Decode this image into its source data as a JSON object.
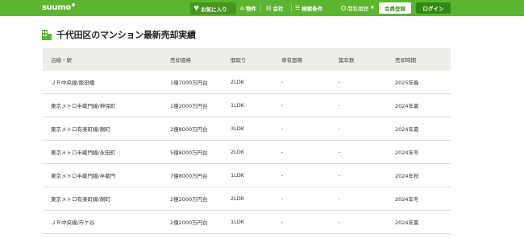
{
  "header": {
    "logo": "suumo",
    "favorites_label": "お気に入り",
    "nav": [
      {
        "label": "物件",
        "icon": "house-icon"
      },
      {
        "label": "会社",
        "icon": "building-icon"
      },
      {
        "label": "検索条件",
        "icon": "search-list-icon"
      }
    ],
    "recent_label": "閲覧履歴",
    "register_label": "会員登録",
    "login_label": "ログイン",
    "colors": {
      "brand": "#5cb531",
      "dark": "#2f8a12"
    }
  },
  "page": {
    "title": "千代田区のマンション最新売却実績",
    "title_icon": "building-icon"
  },
  "table": {
    "headers": [
      "沿線・駅",
      "売却価格",
      "間取り",
      "専有面積",
      "築年数",
      "売却時期"
    ],
    "rows": [
      [
        "ＪＲ中央線/飯田橋",
        "1億7000万円台",
        "2LDK",
        "-",
        "-",
        "2025年春"
      ],
      [
        "東京メトロ半蔵門線/神保町",
        "1億2000万円台",
        "1LDK",
        "-",
        "-",
        "2024年夏"
      ],
      [
        "東京メトロ有楽町線/麹町",
        "2億8000万円台",
        "3LDK",
        "-",
        "-",
        "2024年夏"
      ],
      [
        "東京メトロ半蔵門線/永田町",
        "5億8000万円台",
        "2LDK",
        "-",
        "-",
        "2024年冬"
      ],
      [
        "東京メトロ半蔵門線/半蔵門",
        "7億8000万円台",
        "1LDK",
        "-",
        "-",
        "2024年秋"
      ],
      [
        "東京メトロ有楽町線/麹町",
        "2億2000万円台",
        "2LDK",
        "-",
        "-",
        "2024年冬"
      ],
      [
        "ＪＲ中央線/市ケ谷",
        "2億2000万円台",
        "1LDK",
        "-",
        "-",
        "2024年夏"
      ]
    ]
  }
}
